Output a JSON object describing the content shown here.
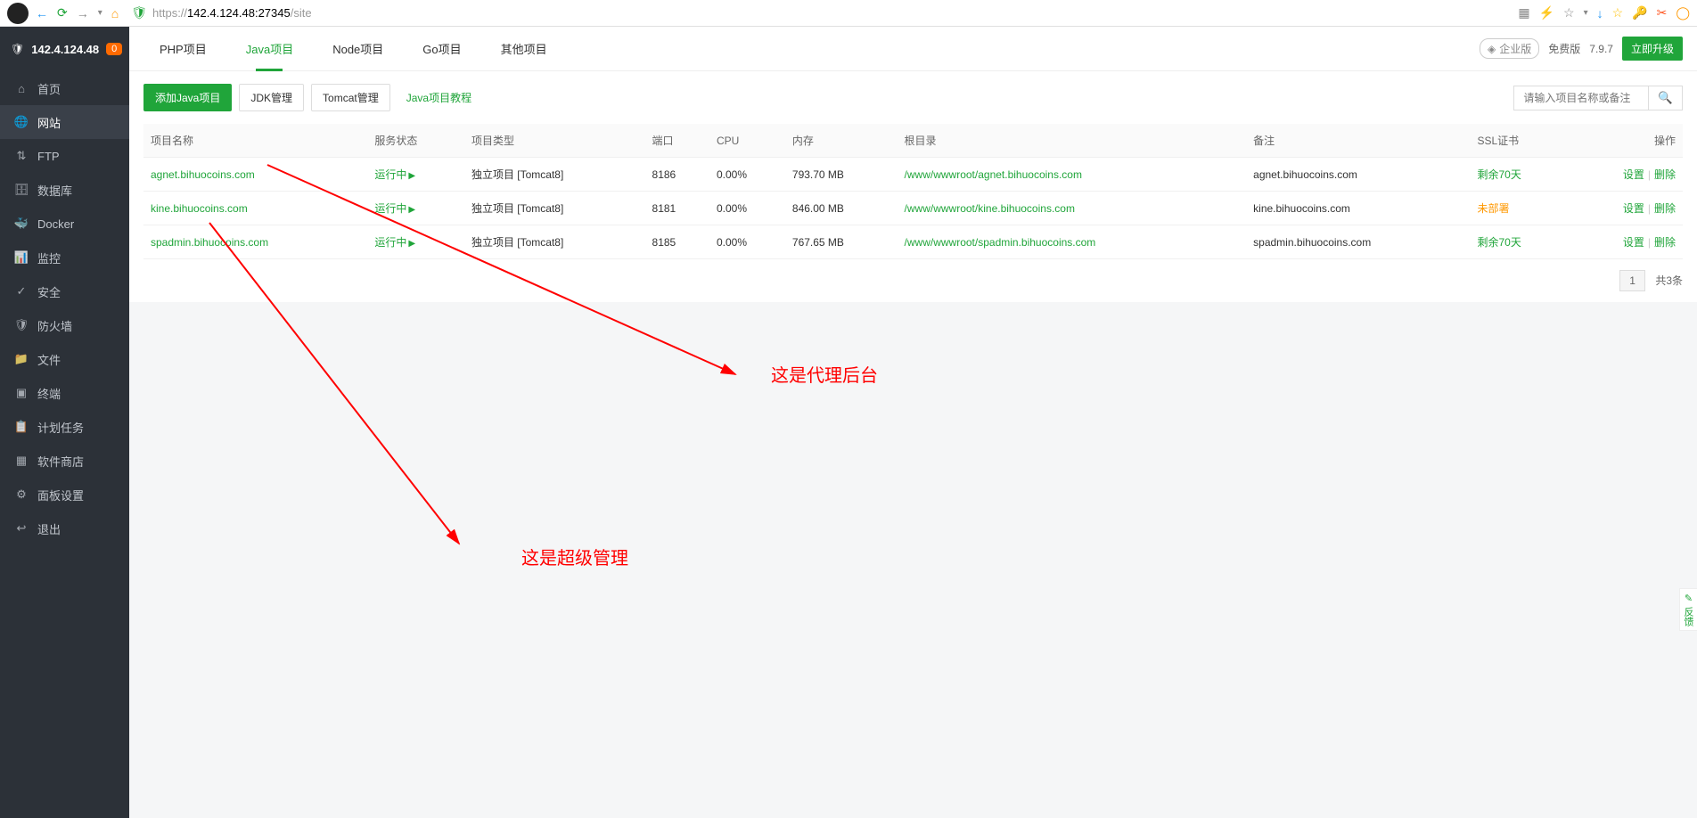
{
  "browser": {
    "url_prefix": "https://",
    "url_host": "142.4.124.48:27345",
    "url_path": "/site"
  },
  "sidebar": {
    "ip": "142.4.124.48",
    "badge": "0",
    "items": [
      {
        "icon": "home",
        "label": "首页"
      },
      {
        "icon": "globe",
        "label": "网站"
      },
      {
        "icon": "ftp",
        "label": "FTP"
      },
      {
        "icon": "db",
        "label": "数据库"
      },
      {
        "icon": "docker",
        "label": "Docker"
      },
      {
        "icon": "monitor",
        "label": "监控"
      },
      {
        "icon": "shield",
        "label": "安全"
      },
      {
        "icon": "fire",
        "label": "防火墙"
      },
      {
        "icon": "folder",
        "label": "文件"
      },
      {
        "icon": "terminal",
        "label": "终端"
      },
      {
        "icon": "task",
        "label": "计划任务"
      },
      {
        "icon": "store",
        "label": "软件商店"
      },
      {
        "icon": "gear",
        "label": "面板设置"
      },
      {
        "icon": "exit",
        "label": "退出"
      }
    ]
  },
  "tabs": {
    "items": [
      "PHP项目",
      "Java项目",
      "Node项目",
      "Go项目",
      "其他项目"
    ],
    "active_index": 1
  },
  "meta": {
    "enterprise": "企业版",
    "free": "免费版",
    "version": "7.9.7",
    "upgrade": "立即升级"
  },
  "toolbar": {
    "add": "添加Java项目",
    "jdk": "JDK管理",
    "tomcat": "Tomcat管理",
    "tutorial": "Java项目教程",
    "search_placeholder": "请输入项目名称或备注"
  },
  "table": {
    "headers": {
      "name": "项目名称",
      "status": "服务状态",
      "type": "项目类型",
      "port": "端口",
      "cpu": "CPU",
      "mem": "内存",
      "root": "根目录",
      "note": "备注",
      "ssl": "SSL证书",
      "ops": "操作"
    },
    "rows": [
      {
        "name": "agnet.bihuocoins.com",
        "status": "运行中",
        "type": "独立项目 [Tomcat8]",
        "port": "8186",
        "cpu": "0.00%",
        "mem": "793.70 MB",
        "root": "/www/wwwroot/agnet.bihuocoins.com",
        "note": "agnet.bihuocoins.com",
        "ssl": "剩余70天",
        "ssl_class": "cell-green"
      },
      {
        "name": "kine.bihuocoins.com",
        "status": "运行中",
        "type": "独立项目 [Tomcat8]",
        "port": "8181",
        "cpu": "0.00%",
        "mem": "846.00 MB",
        "root": "/www/wwwroot/kine.bihuocoins.com",
        "note": "kine.bihuocoins.com",
        "ssl": "未部署",
        "ssl_class": "cell-orange"
      },
      {
        "name": "spadmin.bihuocoins.com",
        "status": "运行中",
        "type": "独立项目 [Tomcat8]",
        "port": "8185",
        "cpu": "0.00%",
        "mem": "767.65 MB",
        "root": "/www/wwwroot/spadmin.bihuocoins.com",
        "note": "spadmin.bihuocoins.com",
        "ssl": "剩余70天",
        "ssl_class": "cell-green"
      }
    ],
    "ops": {
      "set": "设置",
      "del": "删除"
    }
  },
  "pager": {
    "page": "1",
    "total": "共3条"
  },
  "annotations": {
    "a1": "这是代理后台",
    "a2": "这是超级管理"
  },
  "feedback": "反馈"
}
